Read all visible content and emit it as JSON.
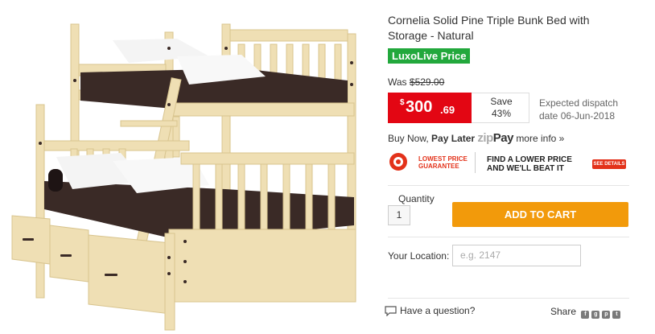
{
  "product": {
    "title": "Cornelia Solid Pine Triple Bunk Bed with Storage - Natural",
    "badge": "LuxoLive Price",
    "was_label": "Was",
    "was_price": "$529.00",
    "price_currency": "$",
    "price_main": "300",
    "price_cents": ".69",
    "save_label": "Save",
    "save_percent": "43%",
    "dispatch": "Expected dispatch date 06-Jun-2018"
  },
  "zippay": {
    "text_before": "Buy Now,",
    "pay_later": "Pay Later",
    "logo_zip": "zip",
    "logo_pay": "Pay",
    "more": "more info »"
  },
  "guarantee": {
    "badge_line1": "LOWEST PRICE",
    "badge_line2": "GUARANTEE",
    "line1": "FIND A LOWER PRICE",
    "line2": "AND WE'LL BEAT IT",
    "details": "SEE DETAILS"
  },
  "purchase": {
    "quantity_label": "Quantity",
    "quantity_value": "1",
    "add_to_cart": "ADD TO CART",
    "location_label": "Your Location:",
    "location_placeholder": "e.g. 2147"
  },
  "footer": {
    "question": "Have a question?",
    "share": "Share",
    "share_icons": [
      "facebook-icon",
      "google-plus-icon",
      "pinterest-icon",
      "twitter-icon"
    ]
  },
  "colors": {
    "price_red": "#e30613",
    "badge_green": "#22a83c",
    "cart_orange": "#f29a0b",
    "wood": "#efdfb4"
  }
}
